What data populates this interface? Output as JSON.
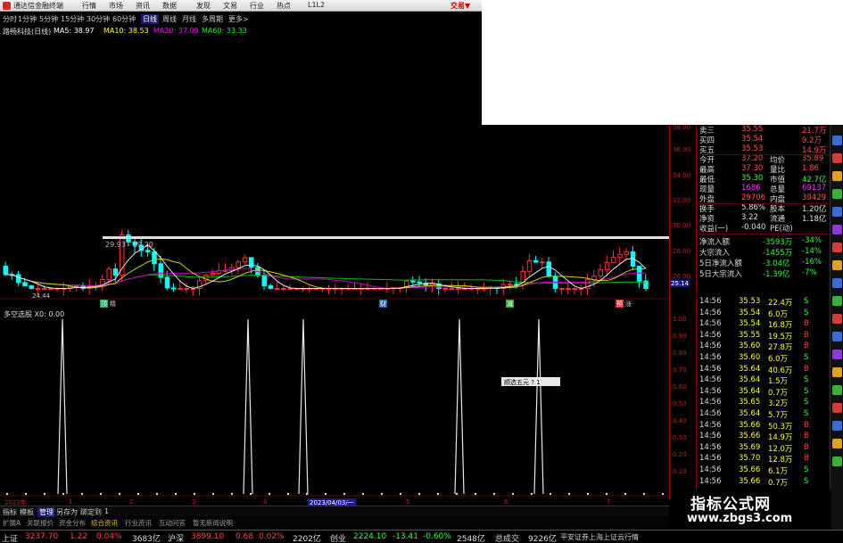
{
  "titlebar": {
    "app": "通达信金融终端",
    "menus": [
      "行情",
      "市场",
      "资讯",
      "数据",
      "发现",
      "文易",
      "行业",
      "热点",
      "L1L2"
    ],
    "trade": "交易▼"
  },
  "periods": [
    "分时",
    "1分钟",
    "5分钟",
    "15分钟",
    "30分钟",
    "60分钟",
    "日线",
    "周线",
    "月线",
    "多周期",
    "更多>"
  ],
  "active_period": "日线",
  "info": {
    "name": "路畅科技(日线)",
    "ma5": "MA5: 38.97",
    "ma10": "MA10: 38.53",
    "ma20": "MA20: 37.09",
    "ma60": "MA60: 33.33"
  },
  "chart_labels": {
    "support": "29.93 - 29.20",
    "low": "24.44",
    "cursor_price": "25.14"
  },
  "tags": [
    "顶",
    "精",
    "财",
    "减",
    "预",
    "涨"
  ],
  "indicator": {
    "title": "多空选股 X0: 0.00",
    "date": "2023/04/03/一",
    "popup": "顺选五元  ?  1"
  },
  "axis_main": [
    "38.00",
    "36.00",
    "34.00",
    "32.00",
    "30.00",
    "28.00",
    "26.00"
  ],
  "axis_ind": [
    "1.00",
    "0.90",
    "0.80",
    "0.70",
    "0.60",
    "0.50",
    "0.40",
    "0.30",
    "0.20",
    "0.10"
  ],
  "x_axis": [
    "2022年",
    "1",
    "2",
    "3",
    "4",
    "5",
    "6",
    "7"
  ],
  "quote": [
    {
      "l": "卖三",
      "v": "35.55",
      "v2": "21.7万",
      "c": "#ff5050"
    },
    {
      "l": "买四",
      "v": "35.54",
      "v2": "9.2万",
      "c": "#ff5050"
    },
    {
      "l": "买五",
      "v": "35.53",
      "v2": "14.9万",
      "c": "#ff5050"
    },
    {
      "l": "今开",
      "v": "37.20",
      "l2": "均价",
      "v2": "35.89",
      "c": "#ff5050"
    },
    {
      "l": "最高",
      "v": "37.30",
      "l2": "量比",
      "v2": "1.86",
      "c": "#ff5050"
    },
    {
      "l": "最低",
      "v": "35.30",
      "l2": "市值",
      "v2": "42.7亿",
      "c": "#30ff30"
    },
    {
      "l": "现量",
      "v": "1686",
      "l2": "总量",
      "v2": "69137",
      "c": "#ff30ff"
    },
    {
      "l": "外盘",
      "v": "29706",
      "l2": "内盘",
      "v2": "39429",
      "c": "#ff5050"
    },
    {
      "l": "换手",
      "v": "5.86%",
      "l2": "股本",
      "v2": "1.20亿",
      "c": "#e0e0e0"
    },
    {
      "l": "净资",
      "v": "3.22",
      "l2": "流通",
      "v2": "1.18亿",
      "c": "#e0e0e0"
    },
    {
      "l": "收益(一)",
      "v": "-0.040",
      "l2": "PE(动)",
      "v2": "",
      "c": "#e0e0e0"
    },
    {
      "l": "净流入额",
      "v": "-3593万",
      "v2": "-34%",
      "c": "#30ff30"
    },
    {
      "l": "大宗流入",
      "v": "-1455万",
      "v2": "-14%",
      "c": "#30ff30"
    },
    {
      "l": "5日净流入额",
      "v": "-3.04亿",
      "v2": "-16%",
      "c": "#30ff30"
    },
    {
      "l": "5日大宗流入",
      "v": "-1.39亿",
      "v2": "-7%",
      "c": "#30ff30"
    }
  ],
  "ticks": [
    {
      "t": "14:56",
      "p": "35.53",
      "v": "22.4万",
      "s": "S"
    },
    {
      "t": "14:56",
      "p": "35.54",
      "v": "6.0万",
      "s": "S"
    },
    {
      "t": "14:56",
      "p": "35.54",
      "v": "16.8万",
      "s": "B"
    },
    {
      "t": "14:56",
      "p": "35.55",
      "v": "19.5万",
      "s": "B"
    },
    {
      "t": "14:56",
      "p": "35.60",
      "v": "27.8万",
      "s": "B"
    },
    {
      "t": "14:56",
      "p": "35.60",
      "v": "6.0万",
      "s": "S"
    },
    {
      "t": "14:56",
      "p": "35.64",
      "v": "40.6万",
      "s": "B"
    },
    {
      "t": "14:56",
      "p": "35.64",
      "v": "1.5万",
      "s": "S"
    },
    {
      "t": "14:56",
      "p": "35.64",
      "v": "0.7万",
      "s": "S"
    },
    {
      "t": "14:56",
      "p": "35.65",
      "v": "3.2万",
      "s": "S"
    },
    {
      "t": "14:56",
      "p": "35.64",
      "v": "5.7万",
      "s": "S"
    },
    {
      "t": "14:56",
      "p": "35.66",
      "v": "50.3万",
      "s": "B"
    },
    {
      "t": "14:56",
      "p": "35.66",
      "v": "14.9万",
      "s": "B"
    },
    {
      "t": "14:56",
      "p": "35.69",
      "v": "12.0万",
      "s": "B"
    },
    {
      "t": "14:56",
      "p": "35.70",
      "v": "12.8万",
      "s": "B"
    },
    {
      "t": "14:56",
      "p": "35.66",
      "v": "6.1万",
      "s": "S"
    },
    {
      "t": "14:56",
      "p": "35.66",
      "v": "0.7万",
      "s": "S"
    }
  ],
  "bottomtabs": [
    "指标",
    "模板",
    "管理",
    "另存为",
    "绑定到",
    " 1 "
  ],
  "subtabs": [
    "扩展A",
    "关联报价",
    "资金分布",
    "综合资讯",
    "行业资讯",
    "互动问答",
    "暂无新闻说明"
  ],
  "status": {
    "sh_label": "上证",
    "sh": "3237.70",
    "sh_chg": "1.22",
    "sh_pct": "0.04%",
    "sh_amt": "3683亿",
    "sz_label": "沪深",
    "sz": "3899.10",
    "sz_chg": "0.68",
    "sz_pct": "0.02%",
    "sz_amt": "2202亿",
    "cy_label": "创业",
    "cy": "2224.10",
    "cy_chg": "-13.41",
    "cy_pct": "-0.60%",
    "cy_amt": "2548亿",
    "tot_label": "总成交",
    "tot": "9226亿",
    "broker": "平安证券上海上证云行情"
  },
  "watermark": {
    "line1": "指标公式网",
    "line2": "www.zbgs3.com"
  },
  "colors": {
    "up": "#ff3030",
    "down": "#00ffff",
    "ma5": "#ffffff",
    "ma10": "#ffff00",
    "ma20": "#ff00ff",
    "ma60": "#00ff00"
  }
}
